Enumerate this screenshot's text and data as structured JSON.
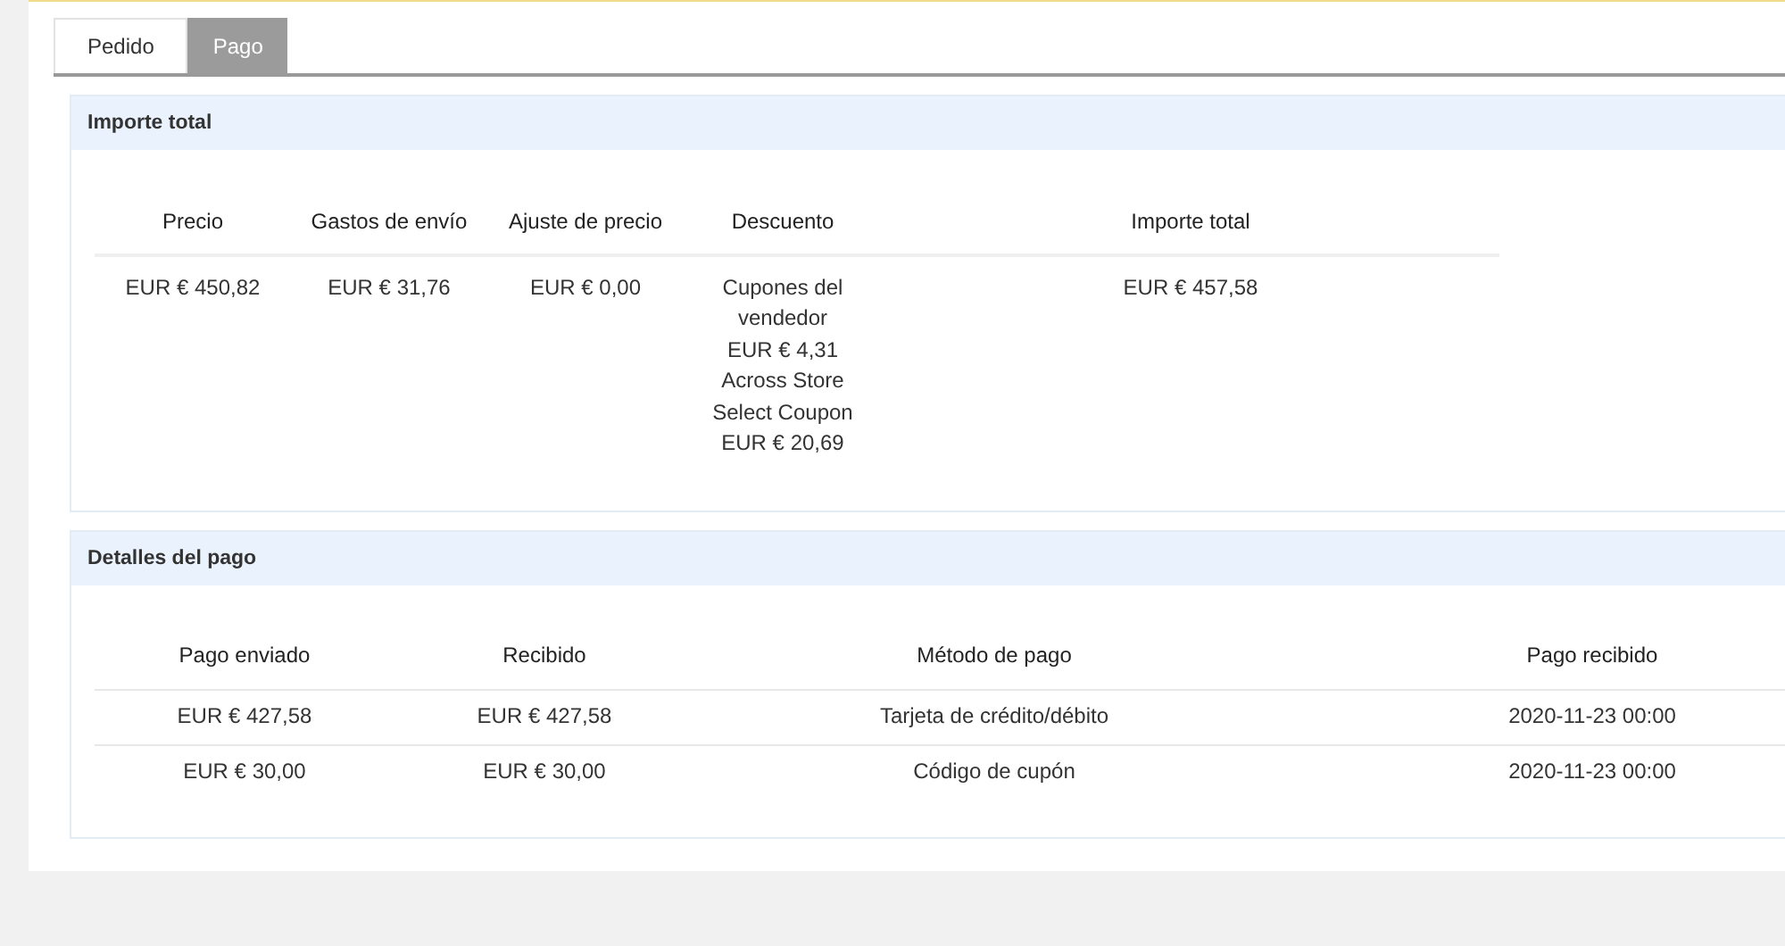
{
  "tabs": [
    {
      "label": "Pedido",
      "selected": false
    },
    {
      "label": "Pago",
      "selected": true
    }
  ],
  "total_section": {
    "title": "Importe total",
    "columns": [
      "Precio",
      "Gastos de envío",
      "Ajuste de precio",
      "Descuento",
      "Importe total"
    ],
    "row": {
      "precio": "EUR € 450,82",
      "gastos_de_envio": "EUR € 31,76",
      "ajuste_de_precio": "EUR € 0,00",
      "descuento": [
        "Cupones del vendedor",
        "EUR € 4,31",
        "Across Store Select Coupon",
        "EUR € 20,69"
      ],
      "importe_total": "EUR € 457,58"
    }
  },
  "payment_section": {
    "title": "Detalles del pago",
    "columns": [
      "Pago enviado",
      "Recibido",
      "Método de pago",
      "Pago recibido"
    ],
    "rows": [
      [
        "EUR € 427,58",
        "EUR € 427,58",
        "Tarjeta de crédito/débito",
        "2020-11-23 00:00"
      ],
      [
        "EUR € 30,00",
        "EUR € 30,00",
        "Código de cupón",
        "2020-11-23 00:00"
      ]
    ]
  }
}
